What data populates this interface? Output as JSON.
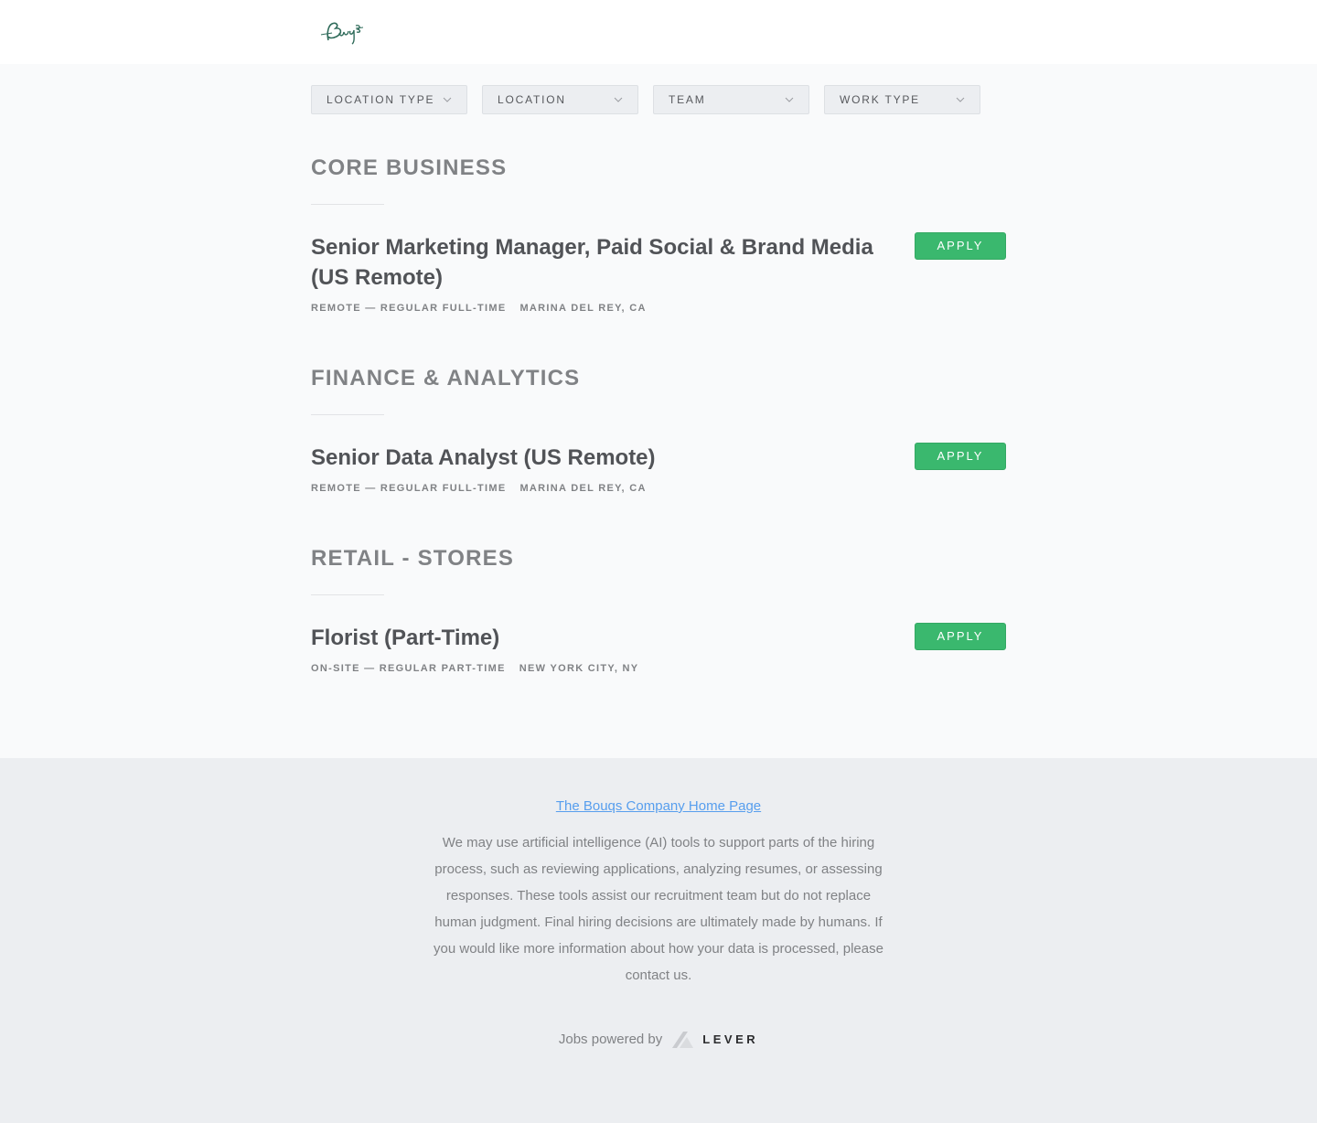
{
  "header": {
    "logo_text": "Bouqs"
  },
  "filters": [
    {
      "label": "LOCATION TYPE"
    },
    {
      "label": "LOCATION"
    },
    {
      "label": "TEAM"
    },
    {
      "label": "WORK TYPE"
    }
  ],
  "groups": [
    {
      "title": "CORE BUSINESS",
      "postings": [
        {
          "title": "Senior Marketing Manager, Paid Social & Brand Media (US Remote)",
          "meta_type": "REMOTE — REGULAR FULL-TIME",
          "meta_location": "MARINA DEL REY, CA",
          "apply_label": "APPLY"
        }
      ]
    },
    {
      "title": "FINANCE & ANALYTICS",
      "postings": [
        {
          "title": "Senior Data Analyst (US Remote)",
          "meta_type": "REMOTE — REGULAR FULL-TIME",
          "meta_location": "MARINA DEL REY, CA",
          "apply_label": "APPLY"
        }
      ]
    },
    {
      "title": "RETAIL - STORES",
      "postings": [
        {
          "title": "Florist (Part-Time)",
          "meta_type": "ON-SITE — REGULAR PART-TIME",
          "meta_location": "NEW YORK CITY, NY",
          "apply_label": "APPLY"
        }
      ]
    }
  ],
  "footer": {
    "home_link": "The Bouqs Company Home Page",
    "ai_notice": "We may use artificial intelligence (AI) tools to support parts of the hiring process, such as reviewing applications, analyzing resumes, or assessing responses. These tools assist our recruitment team but do not replace human judgment. Final hiring decisions are ultimately made by humans. If you would like more information about how your data is processed, please contact us.",
    "powered_by": "Jobs powered by",
    "lever_word": "LEVER"
  },
  "colors": {
    "apply_green": "#3ab86e",
    "link_blue": "#579eee",
    "logo_green": "#2f6b5a"
  }
}
